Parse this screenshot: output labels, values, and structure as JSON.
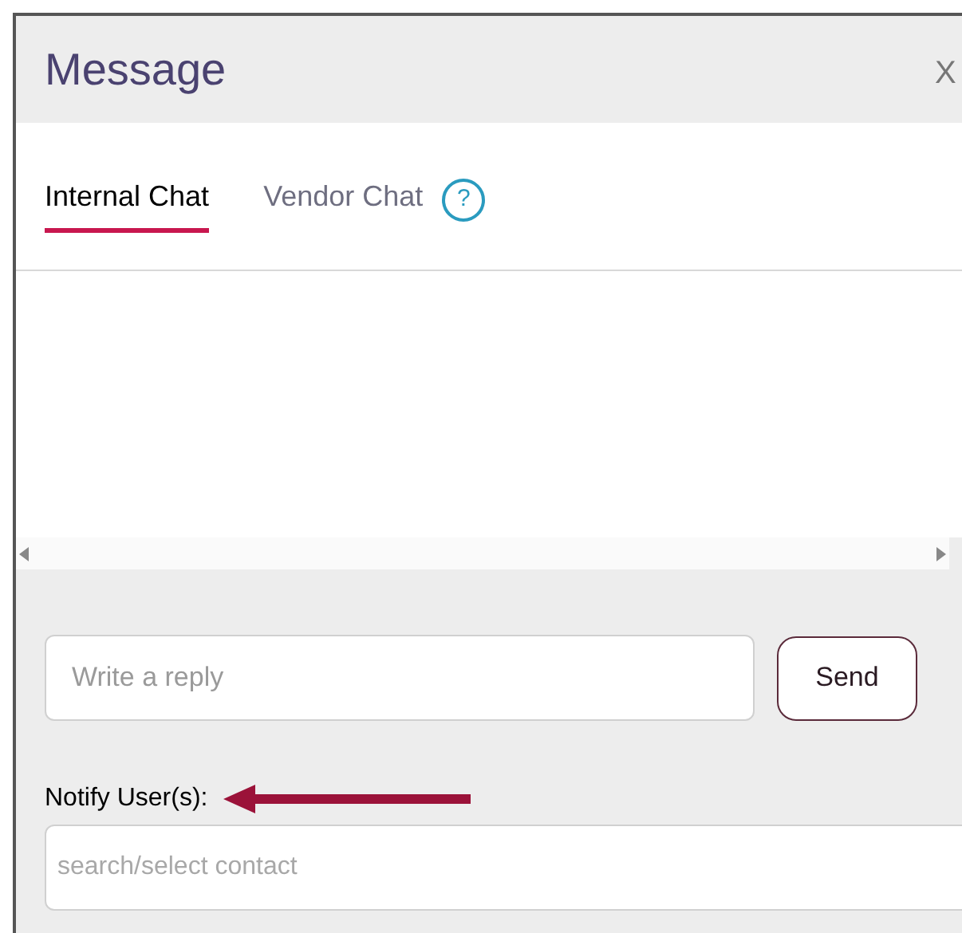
{
  "dialog": {
    "title": "Message",
    "close": "X"
  },
  "tabs": [
    {
      "label": "Internal Chat",
      "selected": true
    },
    {
      "label": "Vendor Chat",
      "selected": false
    }
  ],
  "help": "?",
  "reply": {
    "placeholder": "Write a reply"
  },
  "send_button": "Send",
  "notify": {
    "label": "Notify User(s):",
    "placeholder": "search/select contact"
  }
}
